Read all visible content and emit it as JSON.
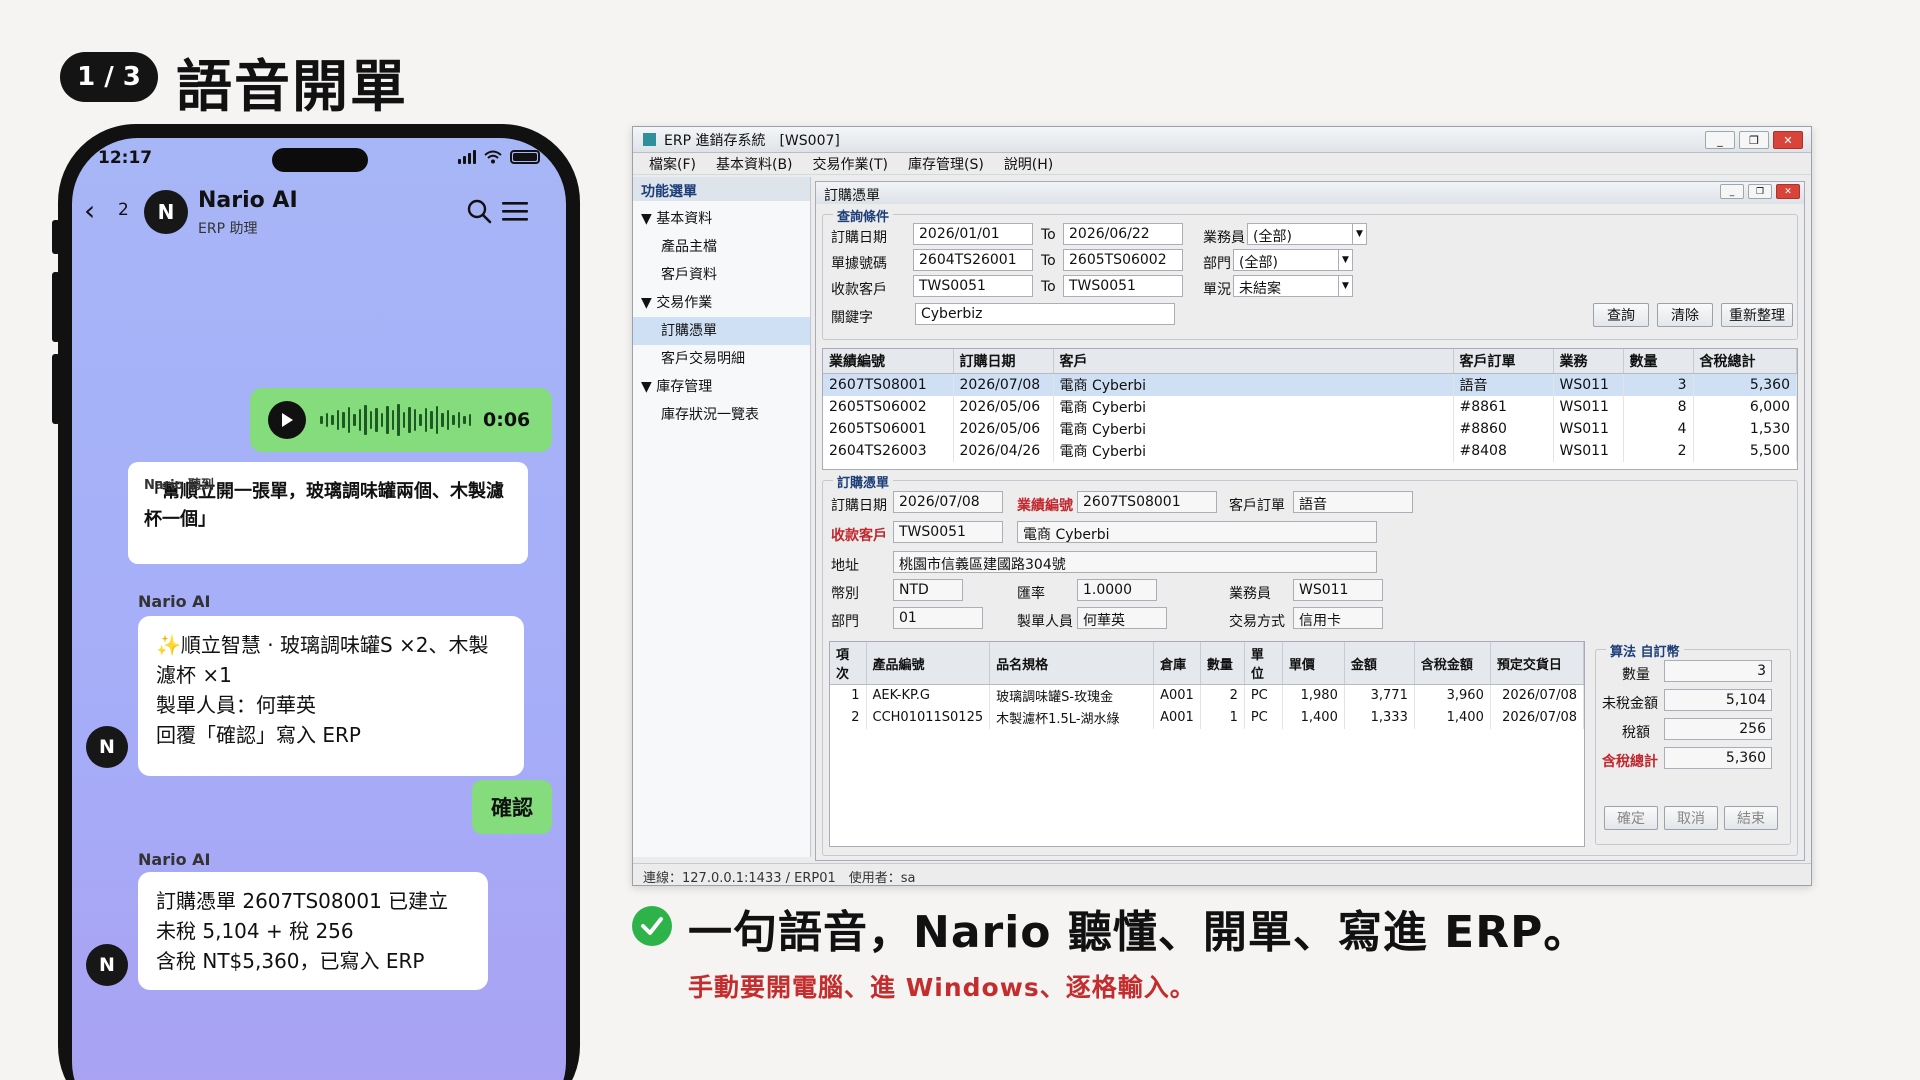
{
  "header": {
    "step": "1 / 3",
    "title": "語音開單"
  },
  "phone": {
    "status": {
      "time": "12:17"
    },
    "chat": {
      "back": "‹",
      "unread": "2",
      "avatar": "N",
      "name": "Nario AI",
      "subtitle": "ERP 助理"
    },
    "voice_message": {
      "duration": "0:06"
    },
    "heard": {
      "label": "Nario 聽到",
      "text": "「幫順立開一張單，玻璃調味罐兩個、木製濾杯一個」"
    },
    "msg1": {
      "sender": "Nario AI",
      "lines": [
        "✨順立智慧 · 玻璃調味罐S ×2、木製濾杯 ×1",
        "製單人員：何華英",
        "回覆「確認」寫入 ERP"
      ]
    },
    "confirm": "確認",
    "msg2": {
      "sender": "Nario AI",
      "lines": [
        "訂購憑單 2607TS08001 已建立",
        "未稅 5,104 + 稅 256",
        "含稅 NT$5,360，已寫入 ERP"
      ]
    }
  },
  "erp": {
    "title": "ERP 進銷存系統　[WS007]",
    "menu": [
      "檔案(F)",
      "基本資料(B)",
      "交易作業(T)",
      "庫存管理(S)",
      "說明(H)"
    ],
    "sidebar": {
      "title": "功能選單",
      "items": [
        {
          "label": "▼ 基本資料"
        },
        {
          "label": "產品主檔"
        },
        {
          "label": "客戶資料"
        },
        {
          "label": "▼ 交易作業"
        },
        {
          "label": "訂購憑單"
        },
        {
          "label": "客戶交易明細"
        },
        {
          "label": "▼ 庫存管理"
        },
        {
          "label": "庫存狀況一覽表"
        }
      ]
    },
    "inner_title": "訂購憑單",
    "query": {
      "group_label": "查詢條件",
      "order_date_label": "訂購日期",
      "order_date_from": "2026/01/01",
      "to1": "To",
      "order_date_to": "2026/06/22",
      "doc_no_label": "單據號碼",
      "doc_no_from": "2604TS26001",
      "to2": "To",
      "doc_no_to": "2605TS06002",
      "customer_label": "收款客戶",
      "customer_from": "TWS0051",
      "to3": "To",
      "customer_to": "TWS0051",
      "keyword_label": "關鍵字",
      "keyword": "Cyberbiz",
      "sales_label": "業務員",
      "sales": "(全部)",
      "dept_label": "部門",
      "dept": "(全部)",
      "status_label": "單況",
      "status": "未結案",
      "btn_query": "查詢",
      "btn_clear": "清除",
      "btn_refresh": "重新整理"
    },
    "list": {
      "columns": [
        "業績編號",
        "訂購日期",
        "客戶",
        "客戶訂單",
        "業務",
        "數量",
        "含稅總計"
      ],
      "rows": [
        [
          "2607TS08001",
          "2026/07/08",
          "電商 Cyberbi",
          "語音",
          "WS011",
          "3",
          "5,360"
        ],
        [
          "2605TS06002",
          "2026/05/06",
          "電商 Cyberbi",
          "#8861",
          "WS011",
          "8",
          "6,000"
        ],
        [
          "2605TS06001",
          "2026/05/06",
          "電商 Cyberbi",
          "#8860",
          "WS011",
          "4",
          "1,530"
        ],
        [
          "2604TS26003",
          "2026/04/26",
          "電商 Cyberbi",
          "#8408",
          "WS011",
          "2",
          "5,500"
        ]
      ]
    },
    "form": {
      "group_label": "訂購憑單",
      "order_date_label": "訂購日期",
      "order_date": "2026/07/08",
      "perf_no_label": "業績編號",
      "perf_no": "2607TS08001",
      "cust_order_label": "客戶訂單",
      "cust_order": "語音",
      "customer_label": "收款客戶",
      "customer_code": "TWS0051",
      "customer_name": "電商 Cyberbi",
      "address_label": "地址",
      "address": "桃園市信義區建國路304號",
      "currency_label": "幣別",
      "currency": "NTD",
      "rate_label": "匯率",
      "rate": "1.0000",
      "sales_label": "業務員",
      "sales": "WS011",
      "dept_label": "部門",
      "dept": "01",
      "maker_label": "製單人員",
      "maker": "何華英",
      "payment_label": "交易方式",
      "payment": "信用卡"
    },
    "lines": {
      "columns": [
        "項次",
        "產品編號",
        "品名規格",
        "倉庫",
        "數量",
        "單位",
        "單價",
        "金額",
        "含稅金額",
        "預定交貨日"
      ],
      "rows": [
        [
          "1",
          "AEK-KP.G",
          "玻璃調味罐S-玫瑰金",
          "A001",
          "2",
          "PC",
          "1,980",
          "3,771",
          "3,960",
          "2026/07/08"
        ],
        [
          "2",
          "CCH01011S0125",
          "木製濾杯1.5L-湖水綠",
          "A001",
          "1",
          "PC",
          "1,400",
          "1,333",
          "1,400",
          "2026/07/08"
        ]
      ]
    },
    "totals": {
      "group_label": "算法 自訂幣",
      "qty_label": "數量",
      "qty": "3",
      "untaxed_label": "未稅金額",
      "untaxed": "5,104",
      "tax_label": "稅額",
      "tax": "256",
      "total_label": "含稅總計",
      "total": "5,360",
      "btn_ok": "確定",
      "btn_cancel": "取消",
      "btn_close": "結束"
    },
    "status_bar": "連線：127.0.0.1:1433 / ERP01　使用者：sa"
  },
  "caption": {
    "headline": "一句語音，Nario 聽懂、開單、寫進 ERP。",
    "subline": "手動要開電腦、進 Windows、逐格輸入。"
  },
  "colors": {
    "bubble_green": "#84dc7c",
    "accent_red": "#c42d2d",
    "check_green": "#2db34a",
    "selected_row": "#cfe0f5"
  }
}
